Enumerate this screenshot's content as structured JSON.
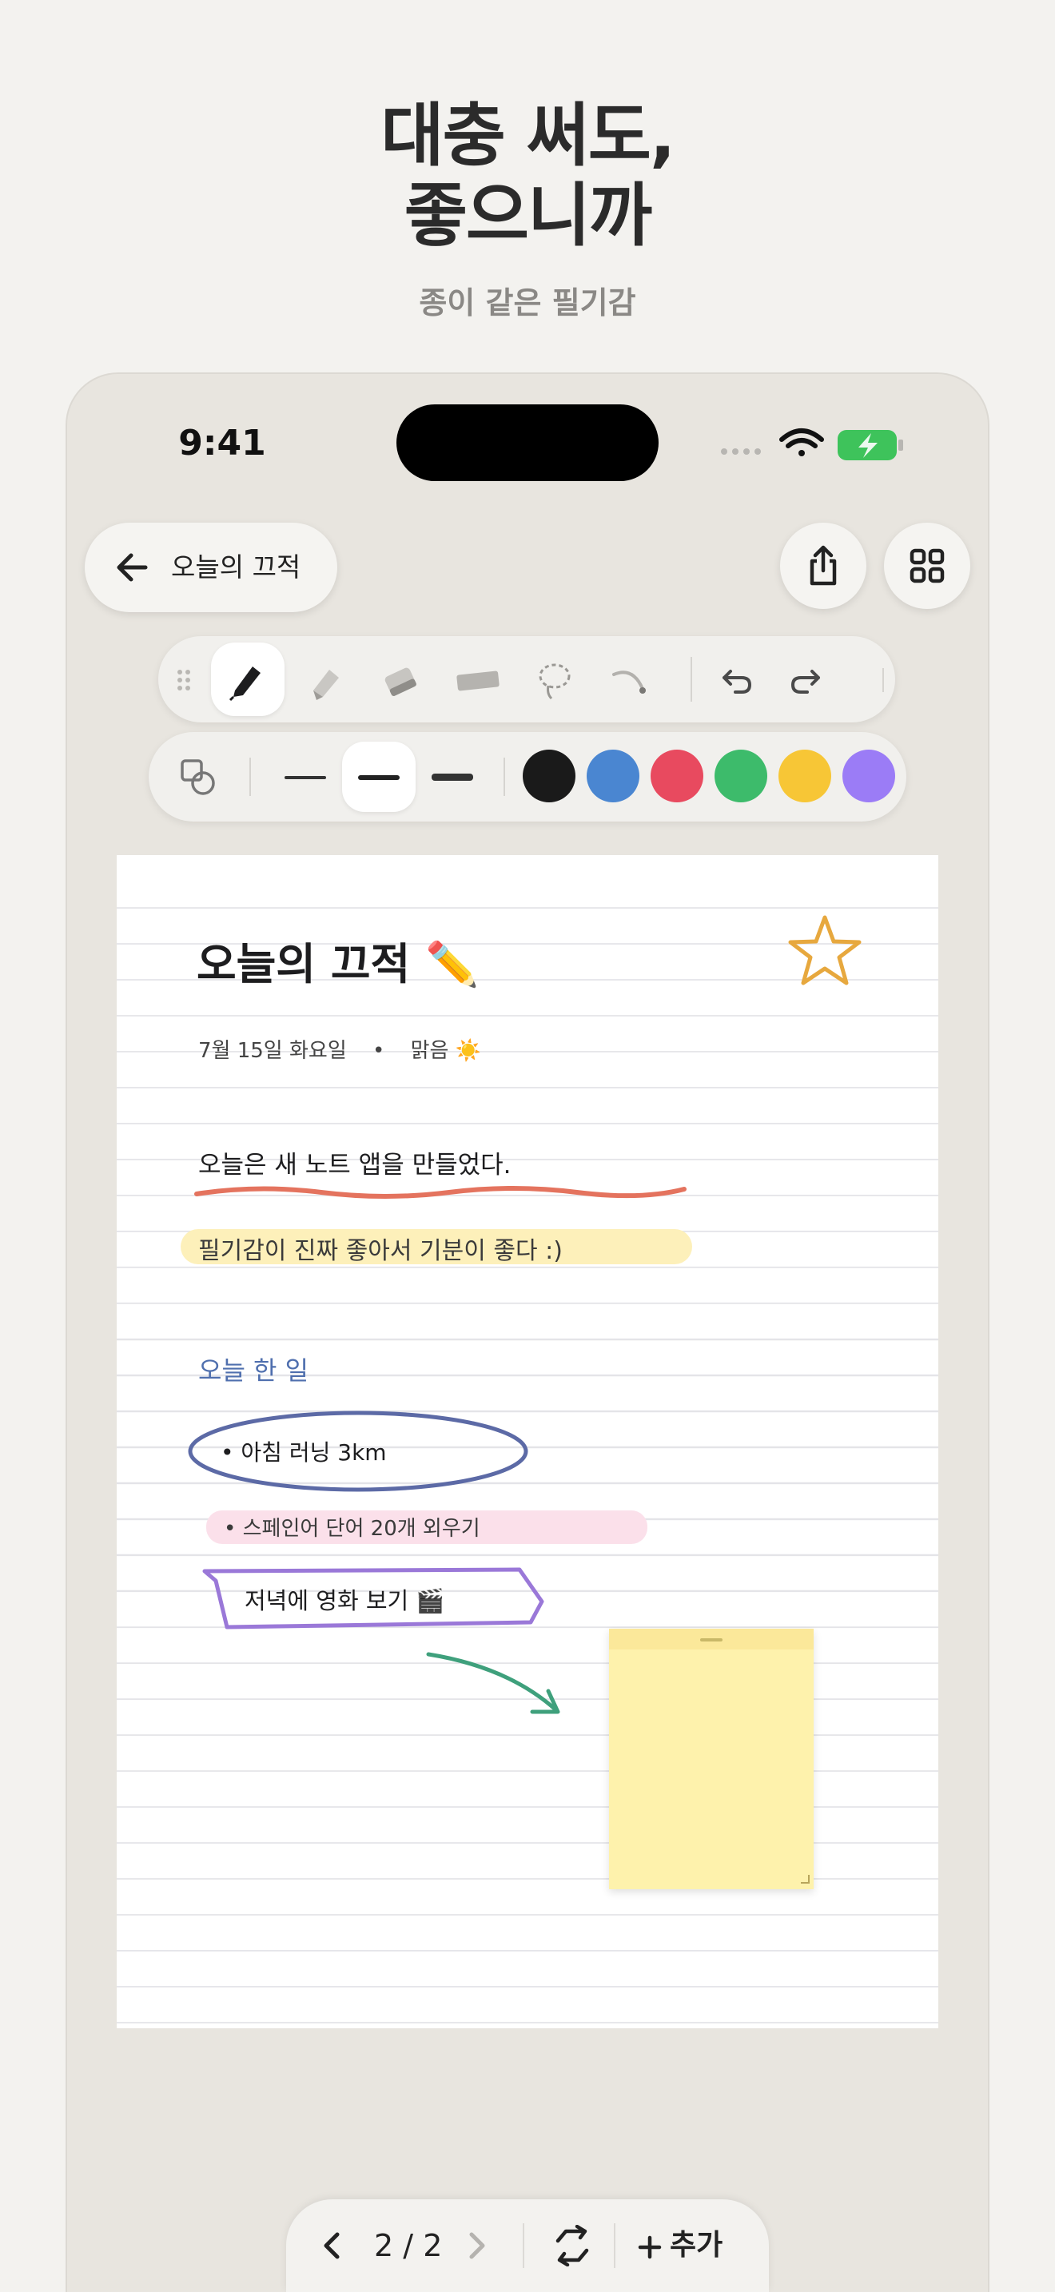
{
  "promo": {
    "headline_line1": "대충 써도,",
    "headline_line2": "좋으니까",
    "subtitle": "종이 같은 필기감"
  },
  "status_bar": {
    "time": "9:41"
  },
  "nav": {
    "back_label": "오늘의 끄적",
    "share_icon": "share-icon",
    "grid_icon": "grid-icon"
  },
  "toolbar": {
    "tools": [
      "pen",
      "marker",
      "eraser",
      "tape",
      "lasso",
      "curve"
    ],
    "active_tool": "pen"
  },
  "options": {
    "stroke_widths": [
      "thin",
      "medium",
      "thick"
    ],
    "selected_width": "medium",
    "colors": [
      "#1a1a1a",
      "#4a86d1",
      "#e84a5f",
      "#3dbb6b",
      "#f7c636",
      "#9b7cf6"
    ]
  },
  "note": {
    "title": "오늘의 끄적",
    "title_emoji": "✏️",
    "date_line": "7월 15일 화요일",
    "weather": "맑음",
    "weather_emoji": "☀️",
    "line1": "오늘은 새 노트 앱을 만들었다.",
    "line2": "필기감이 진짜 좋아서 기분이 좋다 :)",
    "section_title": "오늘 한 일",
    "todo1": "• 아침 러닝 3km",
    "todo2": "• 스페인어 단어 20개 외우기",
    "todo3": "저녁에 영화 보기",
    "todo3_emoji": "🎬"
  },
  "pager": {
    "current": "2",
    "separator": "/",
    "total": "2",
    "add_label": "추가"
  }
}
